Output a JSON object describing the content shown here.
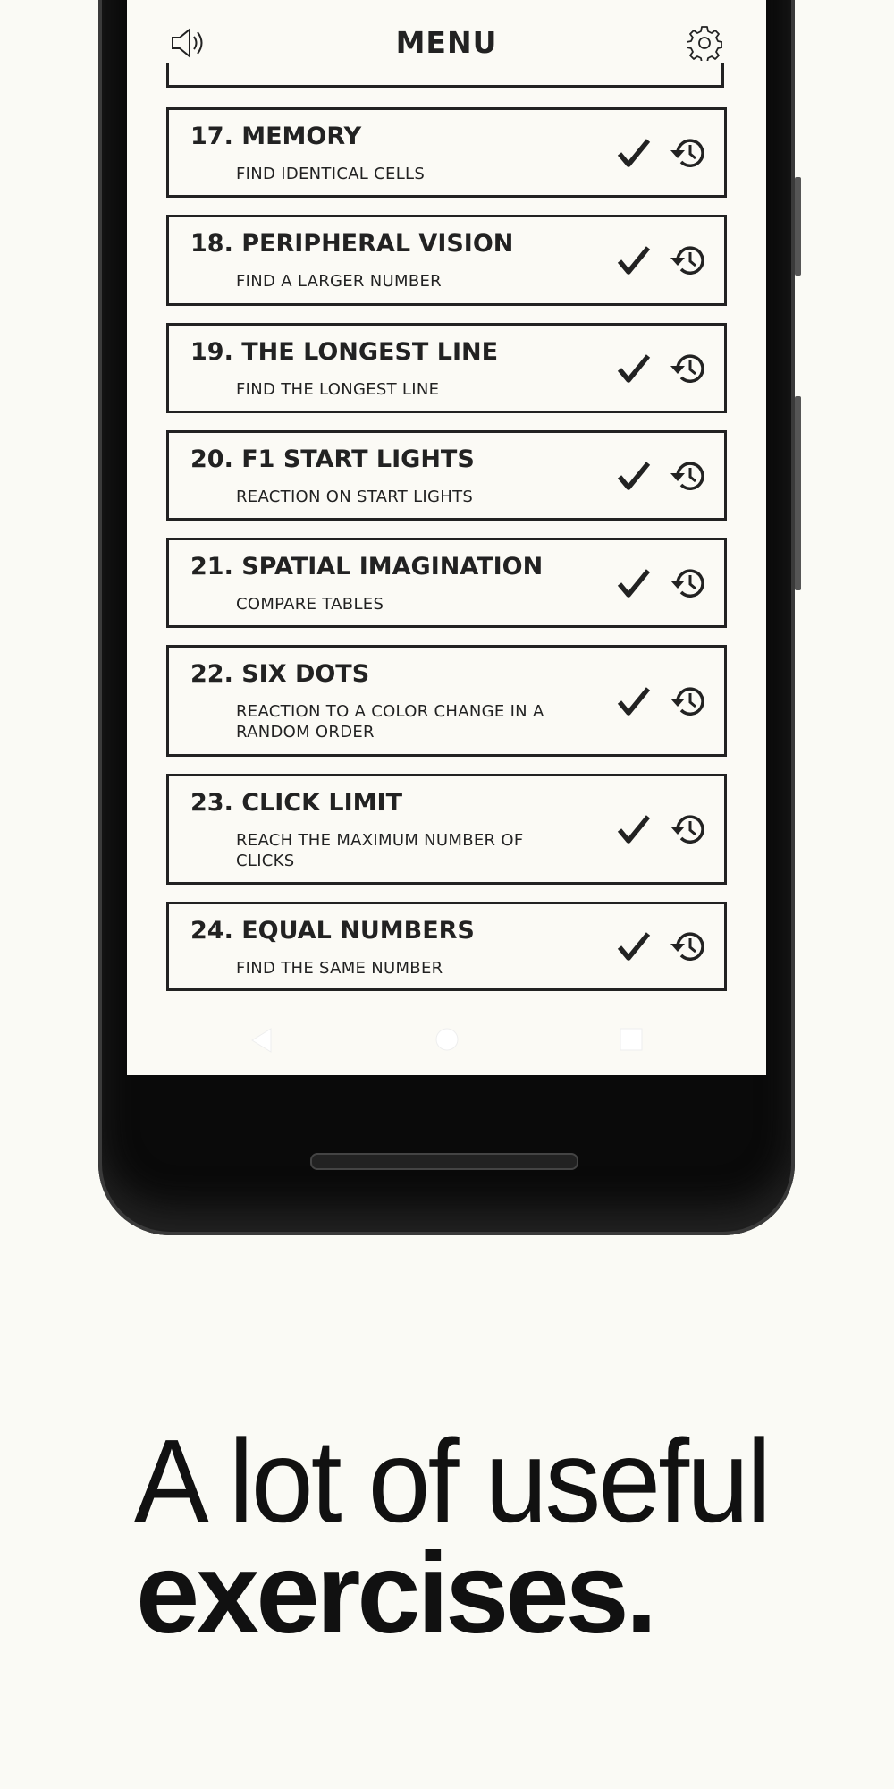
{
  "header": {
    "title": "MENU",
    "left_icon": "speaker-icon",
    "right_icon": "gear-icon"
  },
  "exercises": [
    {
      "title": "17. MEMORY",
      "subtitle": "FIND IDENTICAL CELLS"
    },
    {
      "title": "18. PERIPHERAL VISION",
      "subtitle": "FIND A LARGER NUMBER"
    },
    {
      "title": "19. THE LONGEST LINE",
      "subtitle": "FIND THE LONGEST LINE"
    },
    {
      "title": "20. F1 START LIGHTS",
      "subtitle": "REACTION ON START LIGHTS"
    },
    {
      "title": "21. SPATIAL IMAGINATION",
      "subtitle": "COMPARE TABLES"
    },
    {
      "title": "22. SIX DOTS",
      "subtitle": "REACTION TO A COLOR CHANGE IN A RANDOM ORDER"
    },
    {
      "title": "23. CLICK LIMIT",
      "subtitle": "REACH THE MAXIMUM NUMBER OF CLICKS"
    },
    {
      "title": "24. EQUAL NUMBERS",
      "subtitle": "FIND THE SAME NUMBER"
    }
  ],
  "tagline": {
    "line1": "A lot of useful",
    "line2": "exercises."
  }
}
